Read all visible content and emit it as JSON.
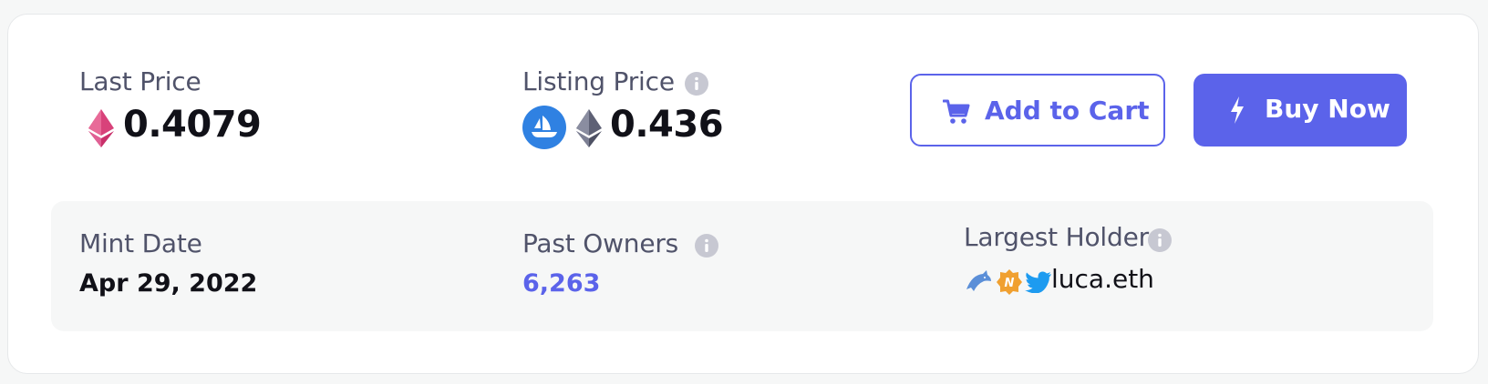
{
  "price_panel": {
    "last_price": {
      "label": "Last Price",
      "value": "0.4079",
      "currency_icon": "eth-pink-icon"
    },
    "listing_price": {
      "label": "Listing Price",
      "value": "0.436",
      "marketplace_icon": "opensea-icon",
      "currency_icon": "eth-gray-icon",
      "info_icon": "info-icon"
    }
  },
  "actions": {
    "add_to_cart": {
      "label": "Add to Cart",
      "icon": "cart-icon"
    },
    "buy_now": {
      "label": "Buy Now",
      "icon": "lightning-icon"
    }
  },
  "stats": {
    "mint_date": {
      "label": "Mint Date",
      "value": "Apr 29, 2022"
    },
    "past_owners": {
      "label": "Past Owners",
      "value": "6,263",
      "info_icon": "info-icon"
    },
    "largest_holder": {
      "label": "Largest Holder",
      "name": "luca.eth",
      "info_icon": "info-icon",
      "badges": [
        "dolphin-icon",
        "verified-badge-icon",
        "twitter-icon"
      ]
    }
  },
  "colors": {
    "accent": "#5b63ea",
    "eth_pink": "#d8427a",
    "opensea_blue": "#2f81e2",
    "twitter_blue": "#1d9bf0",
    "badge_orange": "#f0a030"
  }
}
